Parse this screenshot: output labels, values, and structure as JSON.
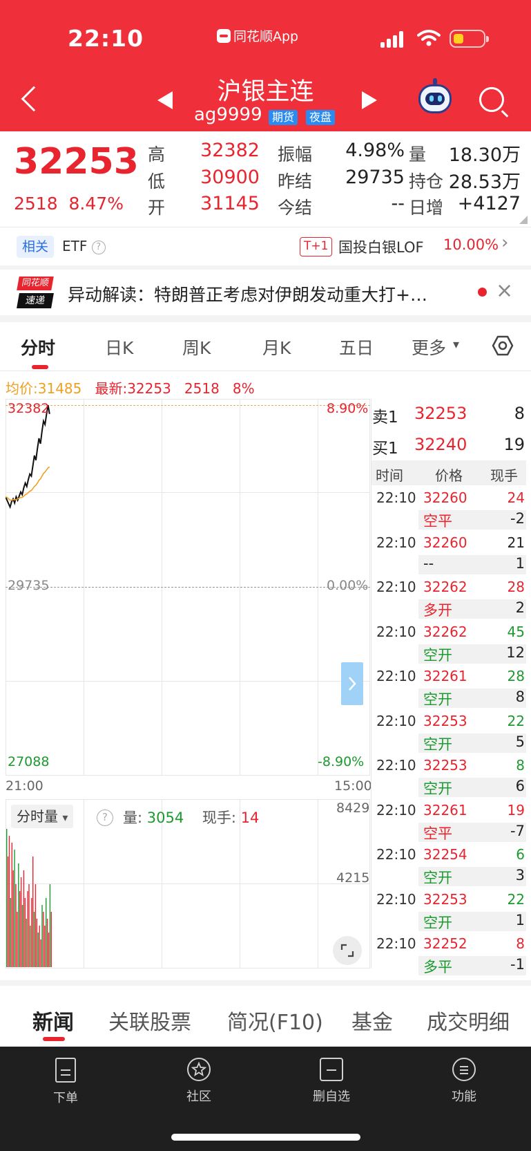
{
  "status_bar": {
    "time": "22:10",
    "app": "同花顺App"
  },
  "header": {
    "title": "沪银主连",
    "code": "ag9999",
    "tags": [
      "期货",
      "夜盘"
    ]
  },
  "quote": {
    "price": "32253",
    "change": "2518",
    "change_pct": "8.47%",
    "rows": [
      [
        {
          "label": "高",
          "value": "32382"
        },
        {
          "label": "振幅",
          "value": "4.98%"
        },
        {
          "label": "量",
          "value": "18.30万"
        }
      ],
      [
        {
          "label": "低",
          "value": "30900"
        },
        {
          "label": "昨结",
          "value": "29735"
        },
        {
          "label": "持仓",
          "value": "28.53万"
        }
      ],
      [
        {
          "label": "开",
          "value": "31145"
        },
        {
          "label": "今结",
          "value": "--"
        },
        {
          "label": "日增",
          "value": "+4127"
        }
      ]
    ]
  },
  "related": {
    "tag": "相关",
    "label": "ETF",
    "help": "?",
    "tplus": "T+1",
    "fund": "国投白银LOF",
    "fund_pct": "10.00%",
    "arrow": "›"
  },
  "news_ticker": {
    "logo_top": "同花顺",
    "logo_bottom": "速递",
    "text": "异动解读：特朗普正考虑对伊朗发动重大打+…",
    "close": "×"
  },
  "chart_tabs": {
    "items": [
      "分时",
      "日K",
      "周K",
      "月K",
      "五日",
      "更多"
    ],
    "active": 0,
    "more_arrow": "▾"
  },
  "chart_info": {
    "avg_label": "均价:",
    "avg": "31485",
    "latest_label": "最新:",
    "latest": "32253",
    "chg": "2518",
    "pct": "8%"
  },
  "chart_axes": {
    "y_top": "32382",
    "y_mid": "29735",
    "y_bottom": "27088",
    "pct_top": "8.90%",
    "pct_mid": "0.00%",
    "pct_bottom": "-8.90%",
    "t_start": "21:00",
    "t_end": "15:00"
  },
  "chart_data": {
    "type": "line",
    "title": "",
    "ylim": [
      27088,
      32382
    ],
    "series": [
      {
        "name": "",
        "color": "#111111",
        "values": [
          31050,
          31000,
          30950,
          30900,
          30980,
          31020,
          30960,
          31050,
          31000,
          31060,
          31120,
          31080,
          31180,
          31250,
          31200,
          31300,
          31380,
          31350,
          31500,
          31650,
          31580,
          31750,
          31900,
          31820,
          32000,
          32150,
          32100,
          32250,
          32382,
          32253
        ]
      },
      {
        "name": "",
        "color": "#f0a020",
        "values": [
          31050,
          31040,
          31020,
          31000,
          31000,
          31010,
          31005,
          31010,
          31020,
          31030,
          31040,
          31040,
          31060,
          31080,
          31090,
          31110,
          31130,
          31140,
          31170,
          31200,
          31220,
          31250,
          31290,
          31310,
          31350,
          31390,
          31410,
          31440,
          31470,
          31485
        ]
      }
    ]
  },
  "volume_chart": {
    "selector": "分时量",
    "selector_arrow": "▾",
    "help": "?",
    "vol_label": "量:",
    "vol": "3054",
    "hand_label": "现手:",
    "hand": "14",
    "y_top": "8429",
    "y_mid": "4215",
    "bars": [
      1,
      0.8,
      0.95,
      0.5,
      0.9,
      0.7,
      0.85,
      0.6,
      0.4,
      0.75,
      0.55,
      0.65,
      0.45,
      0.7,
      0.5,
      0.35,
      0.55,
      0.6,
      0.3,
      0.5,
      0.8,
      0.4,
      0.6,
      0.35,
      0.25,
      0.3,
      0.2,
      0.45,
      0.4,
      0.3,
      0.5,
      0.35,
      0.25,
      0.6,
      0.4
    ],
    "bar_colors": [
      "#e8242f",
      "#1c9a2f"
    ]
  },
  "order_book": {
    "sell": {
      "label": "卖1",
      "price": "32253",
      "qty": "8"
    },
    "buy": {
      "label": "买1",
      "price": "32240",
      "qty": "19"
    },
    "headers": [
      "时间",
      "价格",
      "现手"
    ],
    "trades": [
      {
        "time": "22:10",
        "price": "32260",
        "hand": "24",
        "hand_color": "red",
        "type": "空平",
        "type_color": "red",
        "change": "-2"
      },
      {
        "time": "22:10",
        "price": "32260",
        "hand": "21",
        "hand_color": "black",
        "type": "--",
        "type_color": "black",
        "change": "1"
      },
      {
        "time": "22:10",
        "price": "32262",
        "hand": "28",
        "hand_color": "red",
        "type": "多开",
        "type_color": "red",
        "change": "2"
      },
      {
        "time": "22:10",
        "price": "32262",
        "hand": "45",
        "hand_color": "green",
        "type": "空开",
        "type_color": "green",
        "change": "12"
      },
      {
        "time": "22:10",
        "price": "32261",
        "hand": "28",
        "hand_color": "green",
        "type": "空开",
        "type_color": "green",
        "change": "8"
      },
      {
        "time": "22:10",
        "price": "32253",
        "hand": "22",
        "hand_color": "green",
        "type": "空开",
        "type_color": "green",
        "change": "5"
      },
      {
        "time": "22:10",
        "price": "32253",
        "hand": "8",
        "hand_color": "green",
        "type": "空开",
        "type_color": "green",
        "change": "6"
      },
      {
        "time": "22:10",
        "price": "32261",
        "hand": "19",
        "hand_color": "red",
        "type": "空平",
        "type_color": "red",
        "change": "-7"
      },
      {
        "time": "22:10",
        "price": "32254",
        "hand": "6",
        "hand_color": "green",
        "type": "空开",
        "type_color": "green",
        "change": "3"
      },
      {
        "time": "22:10",
        "price": "32253",
        "hand": "22",
        "hand_color": "green",
        "type": "空开",
        "type_color": "green",
        "change": "1"
      },
      {
        "time": "22:10",
        "price": "32252",
        "hand": "8",
        "hand_color": "red",
        "type": "多平",
        "type_color": "green",
        "change": "-1"
      }
    ]
  },
  "bottom_tabs": {
    "items": [
      "新闻",
      "关联股票",
      "简况(F10)",
      "基金",
      "成交明细"
    ],
    "active": 0
  },
  "toolbar": {
    "items": [
      "下单",
      "社区",
      "删自选",
      "功能"
    ]
  },
  "colors": {
    "header_bg": "#ef2f3a",
    "up": "#e8242f",
    "down": "#1c9a2f",
    "avg_line": "#f0a020"
  }
}
